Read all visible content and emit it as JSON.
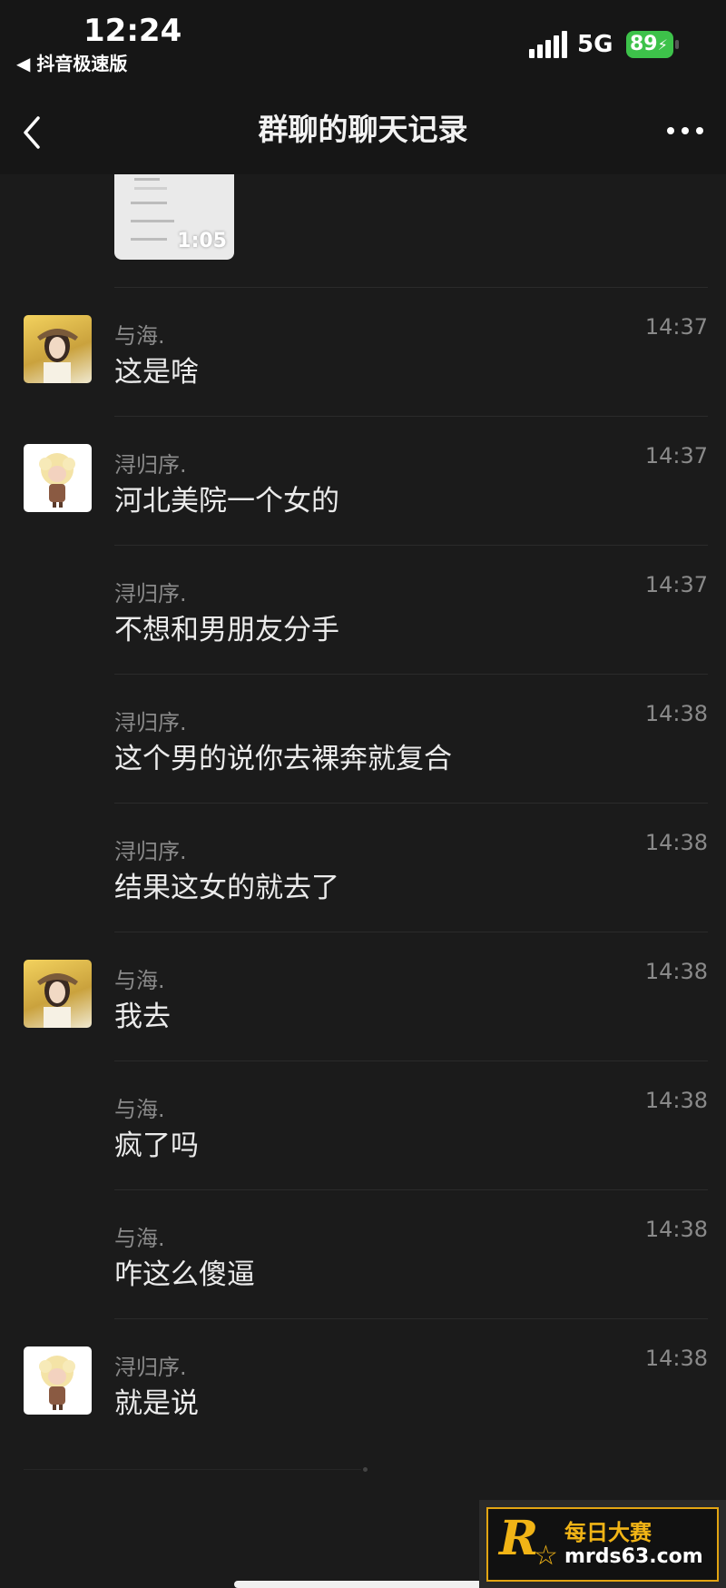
{
  "status_bar": {
    "time": "12:24",
    "back_app": "◀ 抖音极速版",
    "network": "5G",
    "battery": "89",
    "battery_color": "#3dc24a"
  },
  "nav": {
    "title": "群聊的聊天记录"
  },
  "video_thumb": {
    "duration": "1:05"
  },
  "messages": [
    {
      "sender": "与海.",
      "time": "14:37",
      "text": "这是啥"
    },
    {
      "sender": "浔归序.",
      "time": "14:37",
      "text": "河北美院一个女的"
    },
    {
      "sender": "浔归序.",
      "time": "14:37",
      "text": "不想和男朋友分手"
    },
    {
      "sender": "浔归序.",
      "time": "14:38",
      "text": "这个男的说你去裸奔就复合"
    },
    {
      "sender": "浔归序.",
      "time": "14:38",
      "text": "结果这女的就去了"
    },
    {
      "sender": "与海.",
      "time": "14:38",
      "text": "我去"
    },
    {
      "sender": "与海.",
      "time": "14:38",
      "text": "疯了吗"
    },
    {
      "sender": "与海.",
      "time": "14:38",
      "text": "咋这么傻逼"
    },
    {
      "sender": "浔归序.",
      "time": "14:38",
      "text": "就是说"
    }
  ],
  "watermark": {
    "logo_letter": "R",
    "logo_star": "☆",
    "name": "每日大赛",
    "url": "mrds63.com",
    "accent": "#f1b416"
  }
}
